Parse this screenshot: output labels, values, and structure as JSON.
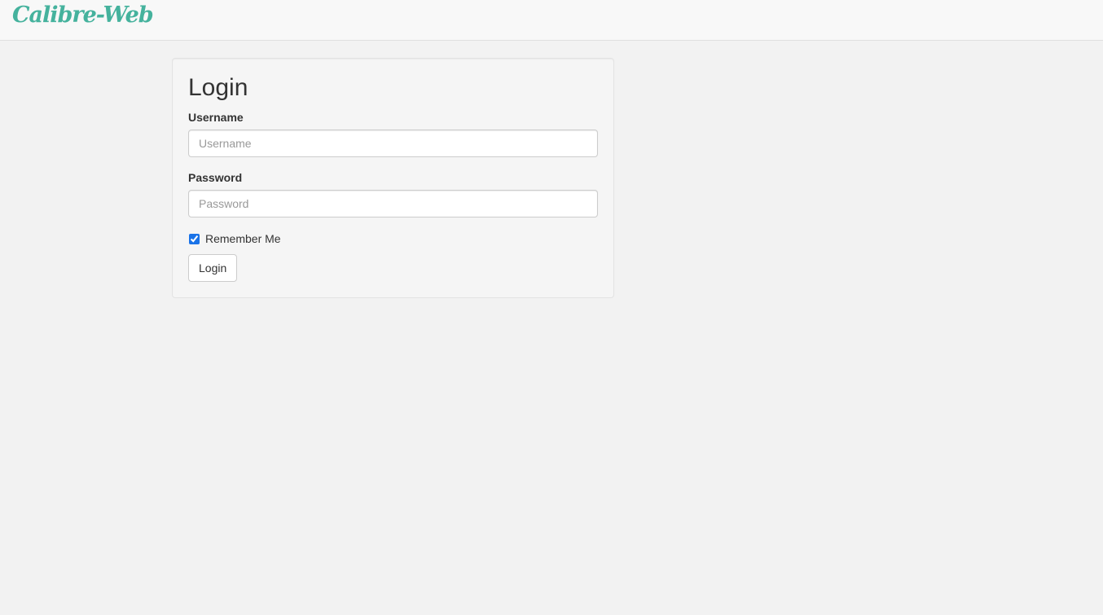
{
  "navbar": {
    "brand": "Calibre-Web"
  },
  "login_form": {
    "title": "Login",
    "username_label": "Username",
    "username_placeholder": "Username",
    "username_value": "",
    "password_label": "Password",
    "password_placeholder": "Password",
    "password_value": "",
    "remember_label": "Remember Me",
    "remember_checked": true,
    "submit_label": "Login"
  },
  "colors": {
    "brand": "#45b29d",
    "background": "#f2f2f2",
    "checkbox_accent": "#1a73e8"
  }
}
